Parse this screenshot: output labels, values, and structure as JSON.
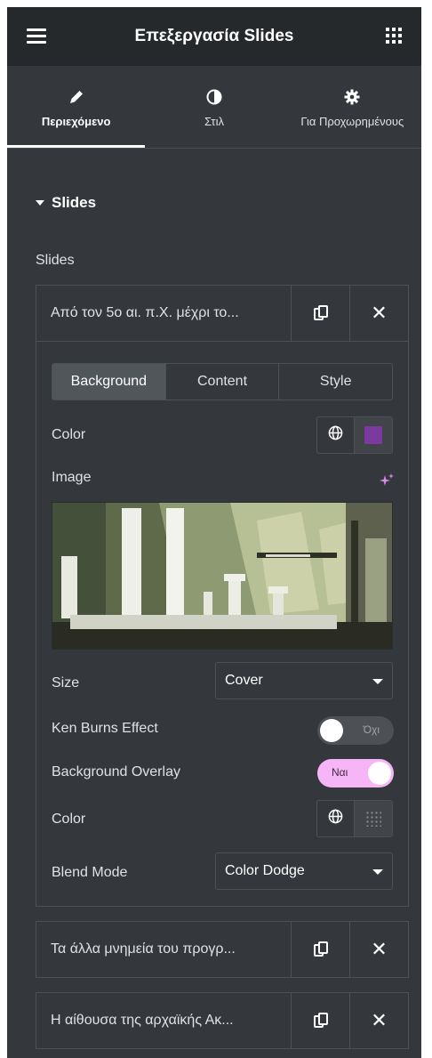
{
  "header": {
    "title": "Επεξεργασία Slides"
  },
  "tabs": [
    {
      "label": "Περιεχόμενο",
      "icon": "pencil-icon",
      "active": true
    },
    {
      "label": "Στιλ",
      "icon": "contrast-icon",
      "active": false
    },
    {
      "label": "Για Προχωρημένους",
      "icon": "gear-icon",
      "active": false
    }
  ],
  "section": {
    "title": "Slides"
  },
  "repeater": {
    "label": "Slides",
    "items": [
      {
        "title": "Από τον 5ο αι. π.Χ. μέχρι το..."
      },
      {
        "title": "Τα άλλα μνημεία του προγρ..."
      },
      {
        "title": "Η αίθουσα της αρχαϊκής Ακ..."
      }
    ]
  },
  "inner_tabs": [
    "Background",
    "Content",
    "Style"
  ],
  "controls": {
    "color_label": "Color",
    "color_value": "#7b3aa0",
    "image_label": "Image",
    "size_label": "Size",
    "size_value": "Cover",
    "ken_burns_label": "Ken Burns Effect",
    "ken_burns_state": "Όχι",
    "overlay_label": "Background Overlay",
    "overlay_state": "Ναι",
    "overlay_color_label": "Color",
    "blend_label": "Blend Mode",
    "blend_value": "Color Dodge"
  },
  "colors": {
    "panel_bg": "#34383c",
    "header_bg": "#26292c",
    "accent_pink": "#f6b5f7"
  }
}
